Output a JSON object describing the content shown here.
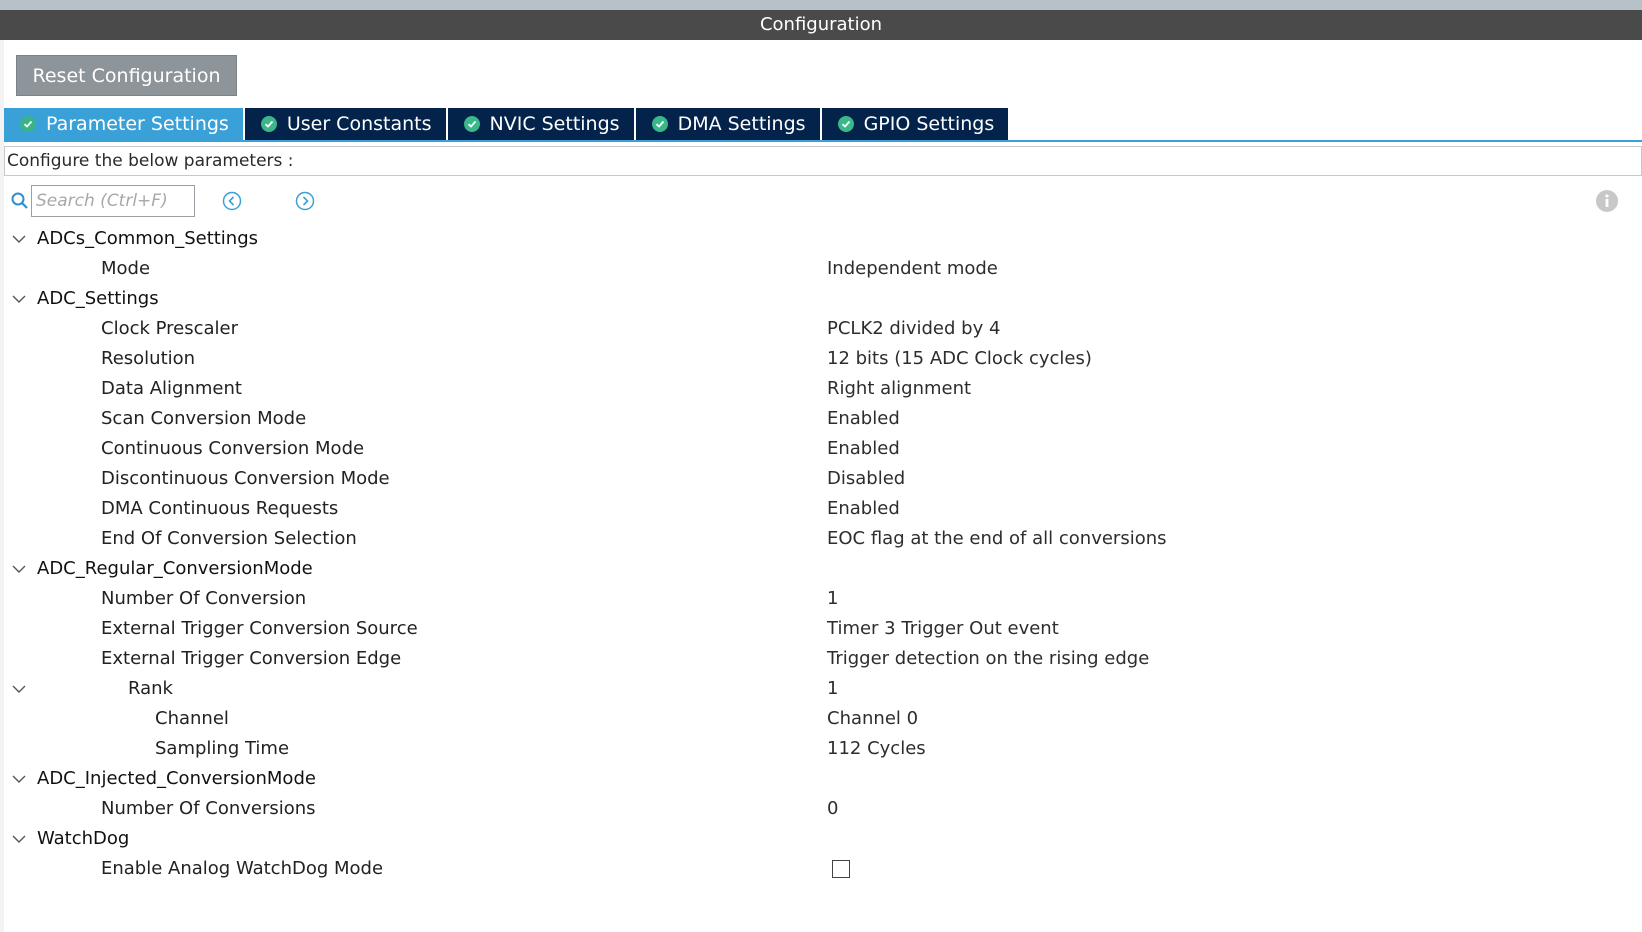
{
  "window": {
    "title": "Configuration"
  },
  "toolbar": {
    "reset_label": "Reset Configuration"
  },
  "tabs": [
    {
      "label": "Parameter Settings",
      "active": true
    },
    {
      "label": "User Constants"
    },
    {
      "label": "NVIC Settings"
    },
    {
      "label": "DMA Settings"
    },
    {
      "label": "GPIO Settings"
    }
  ],
  "colors": {
    "tab_active": "#3aa0d8",
    "tab_inactive": "#03234b",
    "check_green": "#3ab88a",
    "title_bar": "#4a4a4a"
  },
  "configure_label": "Configure the below parameters :",
  "search": {
    "placeholder": "Search (Ctrl+F)",
    "value": ""
  },
  "icons": {
    "search": "search-icon",
    "prev": "prev-result-icon",
    "next": "next-result-icon",
    "info": "info-icon",
    "expand": "chevron-down-icon",
    "tab_check": "check-circle-icon"
  },
  "tree": {
    "adcs_common": {
      "title": "ADCs_Common_Settings",
      "mode": {
        "label": "Mode",
        "value": "Independent mode"
      }
    },
    "adc_settings": {
      "title": "ADC_Settings",
      "clock_prescaler": {
        "label": "Clock Prescaler",
        "value": "PCLK2 divided by 4"
      },
      "resolution": {
        "label": "Resolution",
        "value": "12 bits (15 ADC Clock cycles)"
      },
      "data_alignment": {
        "label": "Data Alignment",
        "value": "Right alignment"
      },
      "scan_conversion": {
        "label": "Scan Conversion Mode",
        "value": "Enabled"
      },
      "continuous_conversion": {
        "label": "Continuous Conversion Mode",
        "value": "Enabled"
      },
      "discontinuous_conversion": {
        "label": "Discontinuous Conversion Mode",
        "value": "Disabled"
      },
      "dma_requests": {
        "label": "DMA Continuous Requests",
        "value": "Enabled"
      },
      "eoc_selection": {
        "label": "End Of Conversion Selection",
        "value": "EOC flag at the end of all conversions"
      }
    },
    "adc_regular": {
      "title": "ADC_Regular_ConversionMode",
      "number_of_conversion": {
        "label": "Number Of Conversion",
        "value": "1"
      },
      "ext_trigger_source": {
        "label": "External Trigger Conversion Source",
        "value": "Timer 3 Trigger Out event"
      },
      "ext_trigger_edge": {
        "label": "External Trigger Conversion Edge",
        "value": "Trigger detection on the rising edge"
      },
      "rank": {
        "label": "Rank",
        "value": "1",
        "channel": {
          "label": "Channel",
          "value": "Channel 0"
        },
        "sampling_time": {
          "label": "Sampling Time",
          "value": "112 Cycles"
        }
      }
    },
    "adc_injected": {
      "title": "ADC_Injected_ConversionMode",
      "number_of_conversions": {
        "label": "Number Of Conversions",
        "value": "0"
      }
    },
    "watchdog": {
      "title": "WatchDog",
      "enable_analog": {
        "label": "Enable Analog WatchDog Mode",
        "checked": false
      }
    }
  }
}
